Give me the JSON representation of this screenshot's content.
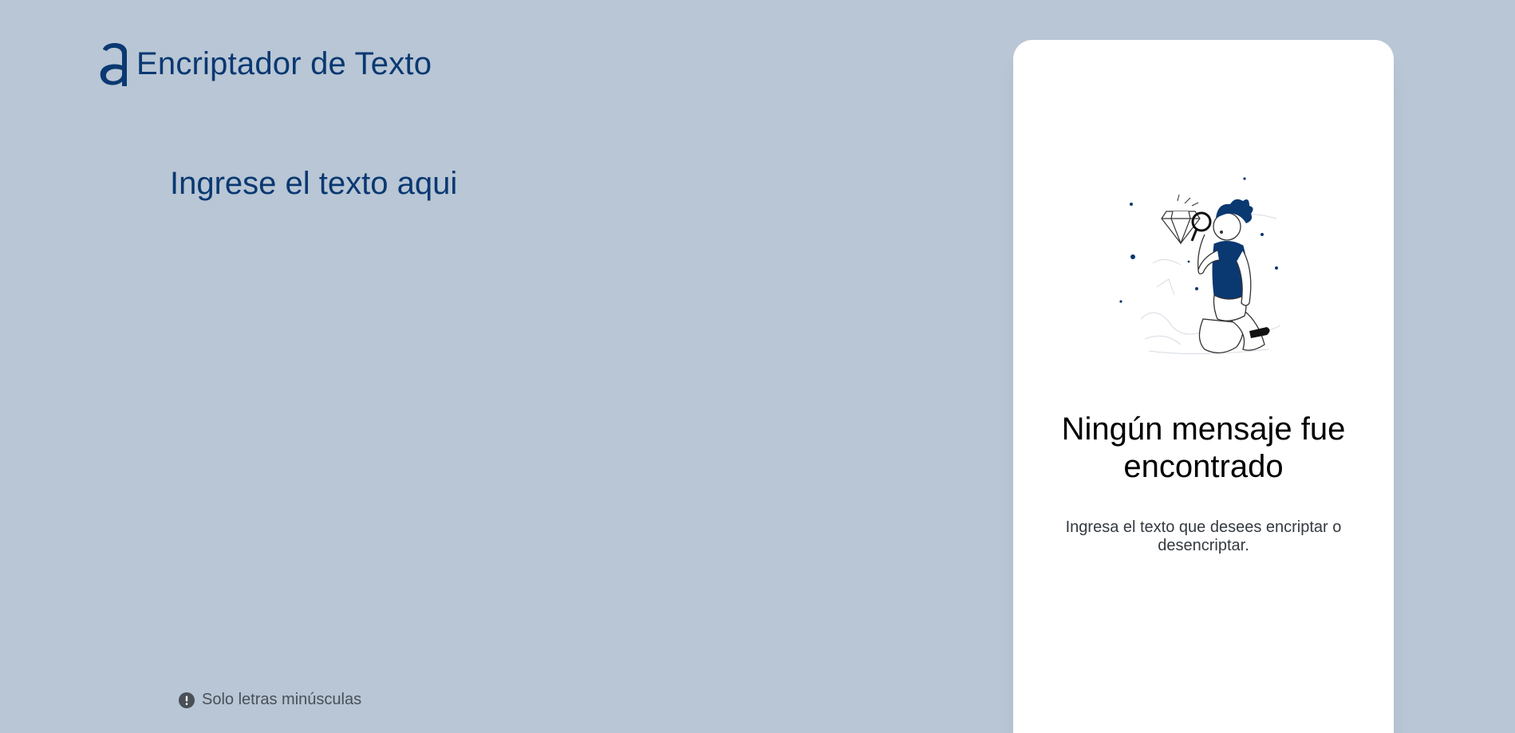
{
  "header": {
    "title": "Encriptador de Texto",
    "logo_icon": "alura-logo-icon",
    "brand_color": "#0a3871"
  },
  "input": {
    "placeholder": "Ingrese el texto aqui",
    "value": ""
  },
  "hint": {
    "icon": "exclamation-circle-icon",
    "text": "Solo letras minúsculas"
  },
  "output": {
    "illustration_icon": "person-with-magnifier-illustration",
    "empty_title": "Ningún mensaje fue encontrado",
    "empty_subtitle": "Ingresa el texto que desees encriptar o desencriptar."
  },
  "colors": {
    "background": "#b8c6d5",
    "panel": "#ffffff",
    "accent": "#0a3871"
  }
}
